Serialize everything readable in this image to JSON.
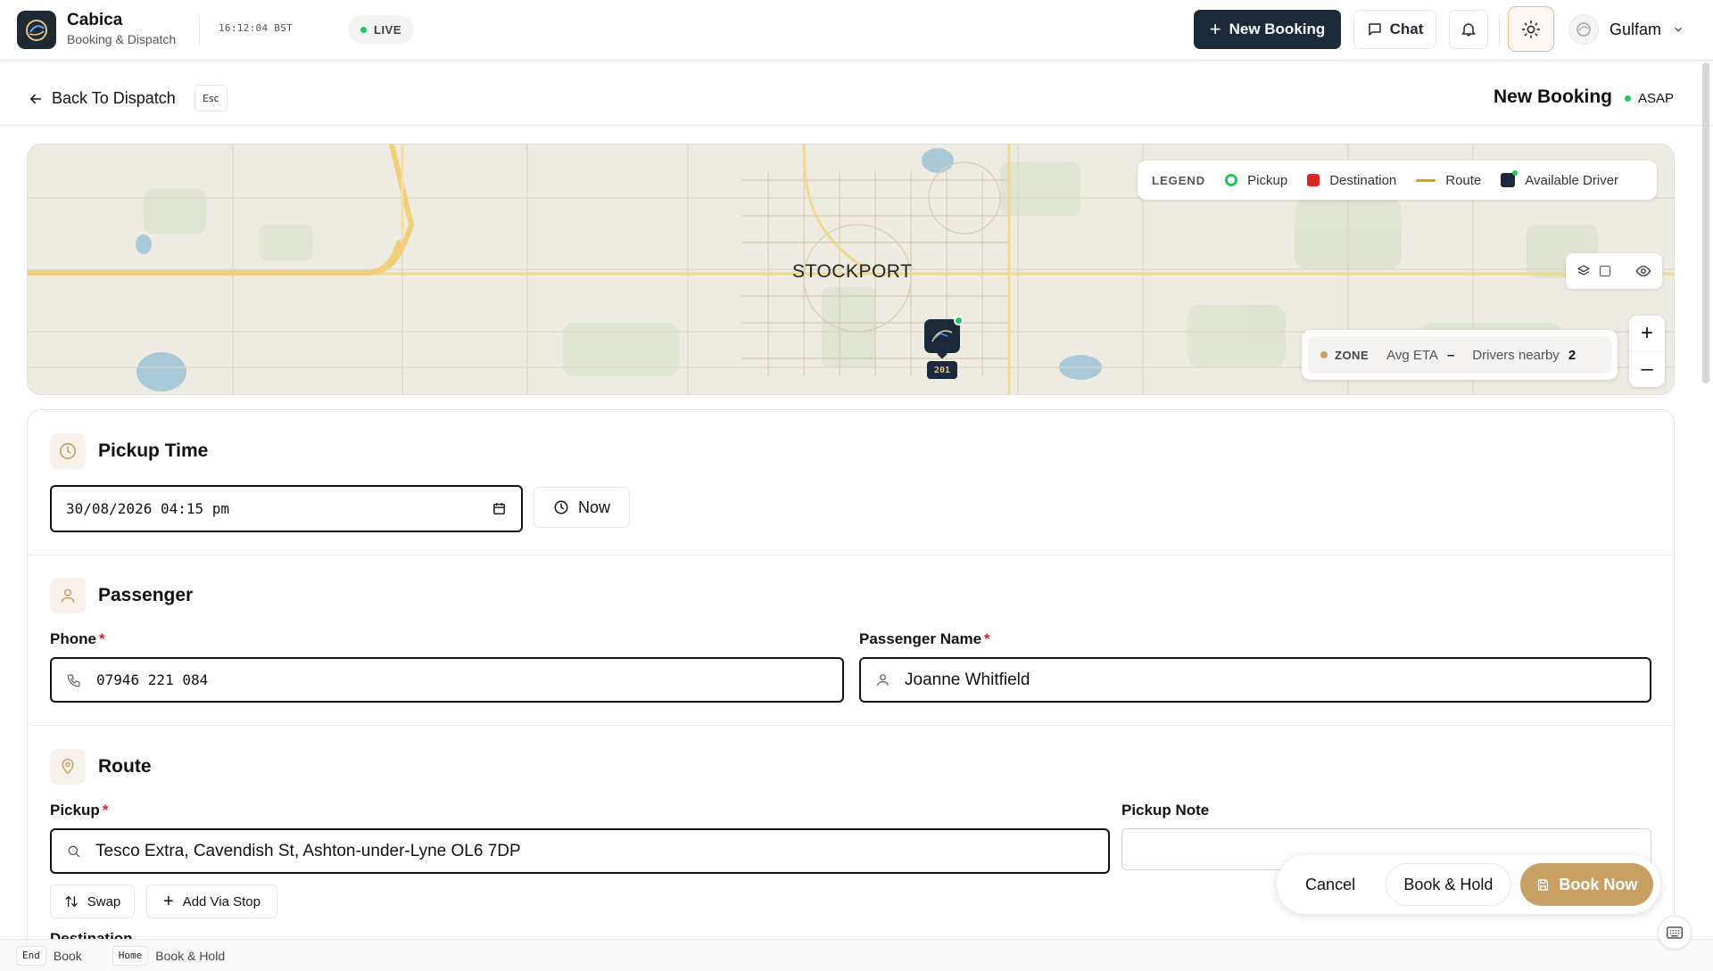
{
  "header": {
    "brand_name": "Cabica",
    "brand_sub": "Booking & Dispatch",
    "clock": "16:12:04 BST",
    "live_label": "LIVE",
    "new_booking_label": "New Booking",
    "chat_label": "Chat",
    "user_name": "Gulfam"
  },
  "subheader": {
    "back_label": "Back To Dispatch",
    "esc_key": "Esc",
    "title": "New Booking",
    "mode": "ASAP"
  },
  "map": {
    "city": "STOCKPORT",
    "legend": {
      "title": "LEGEND",
      "pickup": "Pickup",
      "destination": "Destination",
      "route": "Route",
      "driver": "Available Driver"
    },
    "zone": {
      "label": "ZONE",
      "avg_eta_label": "Avg ETA",
      "avg_eta_value": "–",
      "drivers_label": "Drivers nearby",
      "drivers_value": "2"
    },
    "zoom_in": "+",
    "zoom_out": "–",
    "driver_id": "201"
  },
  "pickup_time": {
    "title": "Pickup Time",
    "datetime_value": "30/08/2026 04:15 pm",
    "now_label": "Now"
  },
  "passenger": {
    "title": "Passenger",
    "phone_label": "Phone",
    "phone_value": "07946 221 084",
    "name_label": "Passenger Name",
    "name_value": "Joanne Whitfield",
    "required_mark": "*"
  },
  "route": {
    "title": "Route",
    "pickup_label": "Pickup",
    "pickup_value": "Tesco Extra, Cavendish St, Ashton-under-Lyne OL6 7DP",
    "pickup_note_label": "Pickup Note",
    "pickup_note_value": "",
    "swap_label": "Swap",
    "add_via_label": "Add Via Stop",
    "destination_label": "Destination"
  },
  "actions": {
    "cancel": "Cancel",
    "book_hold": "Book & Hold",
    "book_now": "Book Now"
  },
  "footer": {
    "end_key": "End",
    "end_action": "Book",
    "home_key": "Home",
    "home_action": "Book & Hold"
  },
  "colors": {
    "primary": "#1b2a3a",
    "accent": "#c9a063",
    "live": "#22c55e",
    "required": "#dc2626"
  }
}
